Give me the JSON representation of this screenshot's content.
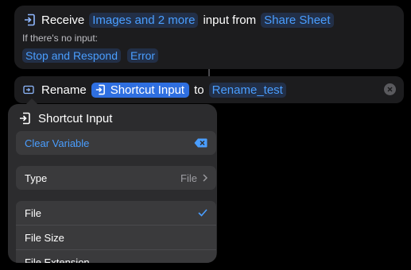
{
  "receive": {
    "verb": "Receive",
    "types_token": "Images and 2 more",
    "middle": "input from",
    "source_token": "Share Sheet",
    "no_input_hint": "If there's no input:",
    "action_token": "Stop and Respond",
    "mode_token": "Error"
  },
  "rename": {
    "verb": "Rename",
    "variable_token": "Shortcut Input",
    "joiner": "to",
    "name_token": "Rename_test"
  },
  "popover": {
    "title": "Shortcut Input",
    "clear_label": "Clear Variable",
    "type_label": "Type",
    "type_value": "File",
    "items": [
      {
        "label": "File",
        "selected": true
      },
      {
        "label": "File Size",
        "selected": false
      },
      {
        "label": "File Extension",
        "selected": false
      }
    ]
  },
  "colors": {
    "accent": "#4a9eff",
    "background": "#000000",
    "card": "#1c1c1e"
  }
}
